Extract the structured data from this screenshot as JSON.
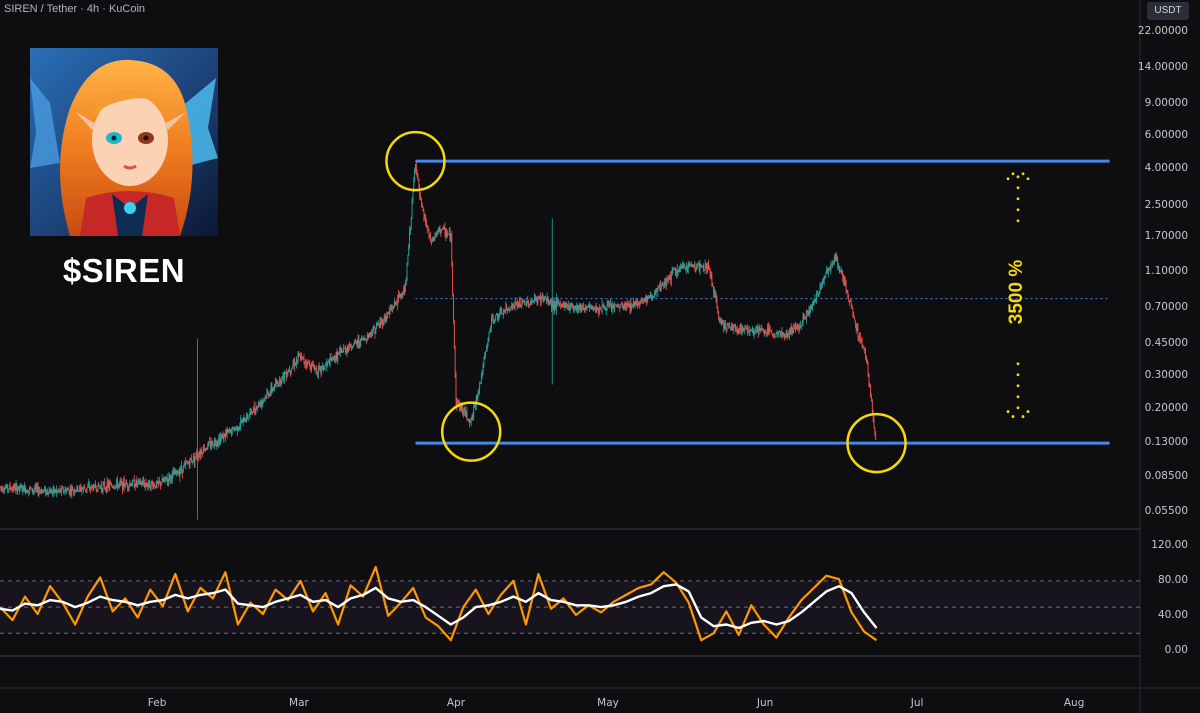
{
  "header": {
    "title": "SIREN / Tether · 4h · KuCoin",
    "currency": "USDT"
  },
  "overlay": {
    "ticker": "$SIREN",
    "range_label": "3500 %"
  },
  "colors": {
    "background": "#0e0e10",
    "up": "#26a69a",
    "down": "#ef5350",
    "levels": "#4a86e8",
    "circles": "#f5d90a",
    "stoch_k": "#ff9800",
    "stoch_d": "#ffffff"
  },
  "chart_data": [
    {
      "type": "candlestick",
      "title": "SIREN / Tether · 4h · KuCoin",
      "y_scale": "log",
      "ylim": [
        0.045,
        25
      ],
      "y_ticks": [
        "22.00000",
        "14.00000",
        "9.00000",
        "6.00000",
        "4.00000",
        "2.50000",
        "1.70000",
        "1.10000",
        "0.70000",
        "0.45000",
        "0.30000",
        "0.20000",
        "0.13000",
        "0.08500",
        "0.05500"
      ],
      "y_tick_values": [
        22,
        14,
        9,
        6,
        4,
        2.5,
        1.7,
        1.1,
        0.7,
        0.45,
        0.3,
        0.2,
        0.13,
        0.085,
        0.055
      ],
      "x_ticks": [
        "Feb",
        "Mar",
        "Apr",
        "May",
        "Jun",
        "Jul",
        "Aug"
      ],
      "x_range": [
        "2025-01-01",
        "2025-08-14"
      ],
      "price_path": [
        [
          "2025-01-01",
          0.075
        ],
        [
          "2025-01-12",
          0.071
        ],
        [
          "2025-01-20",
          0.075
        ],
        [
          "2025-01-28",
          0.079
        ],
        [
          "2025-02-01",
          0.077
        ],
        [
          "2025-02-05",
          0.09
        ],
        [
          "2025-02-10",
          0.12
        ],
        [
          "2025-02-17",
          0.16
        ],
        [
          "2025-02-24",
          0.26
        ],
        [
          "2025-03-01",
          0.38
        ],
        [
          "2025-03-05",
          0.32
        ],
        [
          "2025-03-10",
          0.42
        ],
        [
          "2025-03-14",
          0.48
        ],
        [
          "2025-03-18",
          0.62
        ],
        [
          "2025-03-22",
          0.9
        ],
        [
          "2025-03-24",
          4.4
        ],
        [
          "2025-03-25",
          2.6
        ],
        [
          "2025-03-27",
          1.6
        ],
        [
          "2025-03-29",
          1.9
        ],
        [
          "2025-03-31",
          1.7
        ],
        [
          "2025-04-01",
          0.22
        ],
        [
          "2025-04-04",
          0.17
        ],
        [
          "2025-04-06",
          0.3
        ],
        [
          "2025-04-08",
          0.6
        ],
        [
          "2025-04-12",
          0.72
        ],
        [
          "2025-04-16",
          0.76
        ],
        [
          "2025-04-18",
          0.8
        ],
        [
          "2025-04-20",
          0.74
        ],
        [
          "2025-04-28",
          0.7
        ],
        [
          "2025-05-05",
          0.72
        ],
        [
          "2025-05-10",
          0.82
        ],
        [
          "2025-05-14",
          1.1
        ],
        [
          "2025-05-17",
          1.2
        ],
        [
          "2025-05-21",
          1.15
        ],
        [
          "2025-05-23",
          0.6
        ],
        [
          "2025-05-25",
          0.55
        ],
        [
          "2025-06-02",
          0.52
        ],
        [
          "2025-06-05",
          0.5
        ],
        [
          "2025-06-08",
          0.58
        ],
        [
          "2025-06-11",
          0.78
        ],
        [
          "2025-06-13",
          1.1
        ],
        [
          "2025-06-15",
          1.3
        ],
        [
          "2025-06-17",
          0.9
        ],
        [
          "2025-06-19",
          0.55
        ],
        [
          "2025-06-21",
          0.38
        ],
        [
          "2025-06-23",
          0.12
        ]
      ],
      "spikes": [
        {
          "date": "2025-02-09",
          "high": 0.48,
          "low": 0.05
        },
        {
          "date": "2025-04-20",
          "high": 2.15,
          "low": 0.27
        }
      ],
      "levels": [
        {
          "value": 4.4,
          "from": "2025-03-24",
          "to": "2025-08-08"
        },
        {
          "value": 0.13,
          "from": "2025-03-24",
          "to": "2025-08-08"
        }
      ],
      "dotted_midline": 0.79,
      "circles": [
        {
          "date": "2025-03-24",
          "value": 4.4
        },
        {
          "date": "2025-04-04",
          "value": 0.15
        },
        {
          "date": "2025-06-23",
          "value": 0.13
        }
      ],
      "annotation": {
        "text": "3500 %",
        "from": 0.17,
        "to": 4.0
      }
    },
    {
      "type": "line",
      "title": "",
      "ylim": [
        -5,
        135
      ],
      "y_ticks": [
        "120.00",
        "80.00",
        "40.00",
        "0.00"
      ],
      "y_tick_values": [
        120,
        80,
        40,
        0
      ],
      "bands": [
        20,
        50,
        80
      ],
      "series": [
        {
          "values": [
            50,
            35,
            62,
            42,
            74,
            55,
            30,
            62,
            84,
            45,
            60,
            38,
            70,
            51,
            88,
            45,
            72,
            60,
            90,
            30,
            55,
            42,
            70,
            58,
            80,
            45,
            66,
            30,
            75,
            62,
            96,
            40,
            55,
            72,
            38,
            28,
            12,
            50,
            70,
            42,
            64,
            80,
            30,
            88,
            48,
            60,
            41,
            52,
            44,
            56,
            64,
            72,
            76,
            90,
            78,
            55,
            12,
            20,
            45,
            18,
            52,
            30,
            15,
            38,
            58,
            72,
            86,
            82,
            44,
            22,
            12
          ]
        },
        {
          "values": [
            48,
            46,
            54,
            52,
            58,
            56,
            50,
            55,
            62,
            58,
            56,
            52,
            56,
            58,
            64,
            60,
            64,
            66,
            70,
            54,
            52,
            50,
            56,
            60,
            64,
            56,
            58,
            50,
            60,
            64,
            72,
            60,
            56,
            58,
            50,
            40,
            30,
            38,
            50,
            52,
            56,
            62,
            56,
            66,
            58,
            56,
            52,
            52,
            50,
            52,
            56,
            62,
            66,
            74,
            76,
            68,
            38,
            28,
            30,
            26,
            32,
            34,
            30,
            34,
            44,
            56,
            68,
            74,
            66,
            44,
            26
          ]
        }
      ]
    }
  ]
}
